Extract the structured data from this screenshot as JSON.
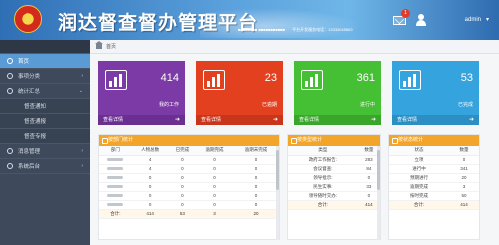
{
  "header": {
    "title": "润达督查督办管理平台",
    "info": [
      "■■■■■■■■ ■■■■■■■■■■■",
      "平台开发服务电话：13333045563"
    ],
    "notification_count": "1",
    "user_name": "admin",
    "colors": {
      "header_blue": "#2f6fb5"
    }
  },
  "sidebar": {
    "items": [
      {
        "label": "首页",
        "icon": "home-icon",
        "active": true,
        "level": 0
      },
      {
        "label": "事项分类",
        "icon": "list-icon",
        "level": 0
      },
      {
        "label": "统计汇总",
        "icon": "chart-icon",
        "level": 0
      },
      {
        "label": "督查通知",
        "level": 1
      },
      {
        "label": "督查通报",
        "level": 1
      },
      {
        "label": "督查专报",
        "level": 1
      },
      {
        "label": "消息管理",
        "icon": "message-icon",
        "level": 0
      },
      {
        "label": "系统后台",
        "icon": "settings-icon",
        "level": 0
      }
    ]
  },
  "breadcrumb": {
    "label": "首页"
  },
  "cards": [
    {
      "value": "414",
      "label": "我的工作",
      "link": "查看详情",
      "color": "#7b3aa5"
    },
    {
      "value": "23",
      "label": "已逾期",
      "link": "查看详情",
      "color": "#e2401f"
    },
    {
      "value": "361",
      "label": "进行中",
      "link": "查看详情",
      "color": "#45bf33"
    },
    {
      "value": "53",
      "label": "已完成",
      "link": "查看详情",
      "color": "#35a3dd"
    }
  ],
  "panels": {
    "dept": {
      "title": "按部门统计",
      "columns": [
        "部门",
        "人物总数",
        "已完成",
        "逾期完成",
        "逾期未完成"
      ],
      "rows": [
        [
          "",
          "4",
          "0",
          "0",
          "0"
        ],
        [
          "",
          "4",
          "0",
          "0",
          "0"
        ],
        [
          "",
          "0",
          "0",
          "0",
          "0"
        ],
        [
          "",
          "0",
          "0",
          "0",
          "0"
        ],
        [
          "",
          "0",
          "0",
          "0",
          "0"
        ],
        [
          "",
          "0",
          "0",
          "0",
          "0"
        ]
      ],
      "total": [
        "合计:",
        "414",
        "53",
        "3",
        "20"
      ]
    },
    "type": {
      "title": "按类型统计",
      "columns": [
        "类型",
        "数量"
      ],
      "rows": [
        [
          "政府工作报告:",
          "283"
        ],
        [
          "会议督查:",
          "84"
        ],
        [
          "领导批示:",
          "0"
        ],
        [
          "民生实事:",
          "33"
        ],
        [
          "领导随时交办:",
          "0"
        ]
      ],
      "total": [
        "合计:",
        "414"
      ]
    },
    "status": {
      "title": "按状态统计",
      "columns": [
        "状态",
        "数量"
      ],
      "rows": [
        [
          "立项",
          "0"
        ],
        [
          "进行中",
          "341"
        ],
        [
          "预期进行",
          "20"
        ],
        [
          "逾期完成",
          "3"
        ],
        [
          "按时完成",
          "50"
        ]
      ],
      "total": [
        "合计:",
        "414"
      ]
    }
  }
}
